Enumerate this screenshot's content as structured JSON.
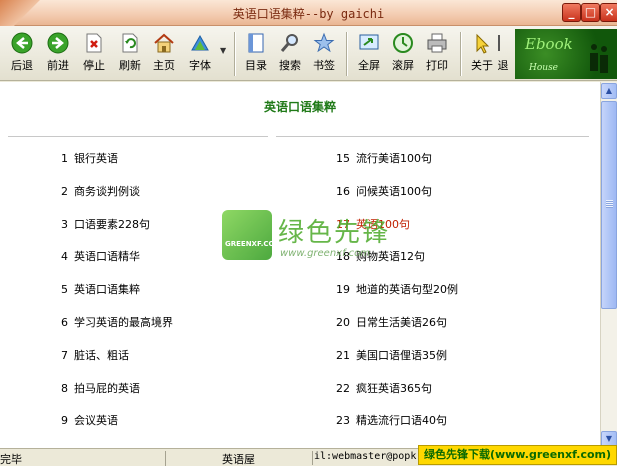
{
  "window": {
    "title": "英语口语集粹--by gaichi"
  },
  "toolbar": [
    {
      "label": "后退",
      "icon": "back-arrow-icon"
    },
    {
      "label": "前进",
      "icon": "forward-arrow-icon"
    },
    {
      "label": "停止",
      "icon": "stop-icon"
    },
    {
      "label": "刷新",
      "icon": "refresh-icon"
    },
    {
      "label": "主页",
      "icon": "home-icon"
    },
    {
      "label": "字体",
      "icon": "font-icon"
    },
    {
      "label": "目录",
      "icon": "contents-icon"
    },
    {
      "label": "搜索",
      "icon": "search-icon"
    },
    {
      "label": "书签",
      "icon": "bookmark-star-icon"
    },
    {
      "label": "全屏",
      "icon": "fullscreen-icon"
    },
    {
      "label": "滚屏",
      "icon": "autoscroll-icon"
    },
    {
      "label": "打印",
      "icon": "print-icon"
    },
    {
      "label": "关于",
      "icon": "about-icon"
    },
    {
      "label": "退",
      "icon": "exit-icon"
    }
  ],
  "logo": {
    "line1": "Ebook",
    "line2": "House"
  },
  "content": {
    "heading": "英语口语集粹",
    "left_list": [
      {
        "num": "1",
        "text": "银行英语"
      },
      {
        "num": "2",
        "text": "商务谈判例谈"
      },
      {
        "num": "3",
        "text": "口语要素228句"
      },
      {
        "num": "4",
        "text": "英语口语精华"
      },
      {
        "num": "5",
        "text": "英语口语集粹"
      },
      {
        "num": "6",
        "text": "学习英语的最高境界"
      },
      {
        "num": "7",
        "text": "脏话、粗话"
      },
      {
        "num": "8",
        "text": "拍马屁的英语"
      },
      {
        "num": "9",
        "text": "会议英语"
      }
    ],
    "right_list": [
      {
        "num": "15",
        "text": "流行美语100句"
      },
      {
        "num": "16",
        "text": "问候英语100句"
      },
      {
        "num": "17",
        "text": "英语100句",
        "highlight": true
      },
      {
        "num": "18",
        "text": "购物英语12句"
      },
      {
        "num": "19",
        "text": "地道的英语句型20例"
      },
      {
        "num": "20",
        "text": "日常生活美语26句"
      },
      {
        "num": "21",
        "text": "美国口语俚语35例"
      },
      {
        "num": "22",
        "text": "疯狂英语365句"
      },
      {
        "num": "23",
        "text": "精选流行口语40句"
      }
    ]
  },
  "watermark": {
    "brand": "绿色先锋",
    "box_text": "GREENXF.COM",
    "url": "www.greenxf.com"
  },
  "statusbar": {
    "left": "完毕",
    "middle": "英语屋",
    "email": "il:webmaster@popk",
    "banner": "绿色先锋下载(www.greenxf.com)"
  },
  "colors": {
    "heading": "#207a18",
    "highlight": "#c02000",
    "scroll": "#b0c6f7"
  }
}
